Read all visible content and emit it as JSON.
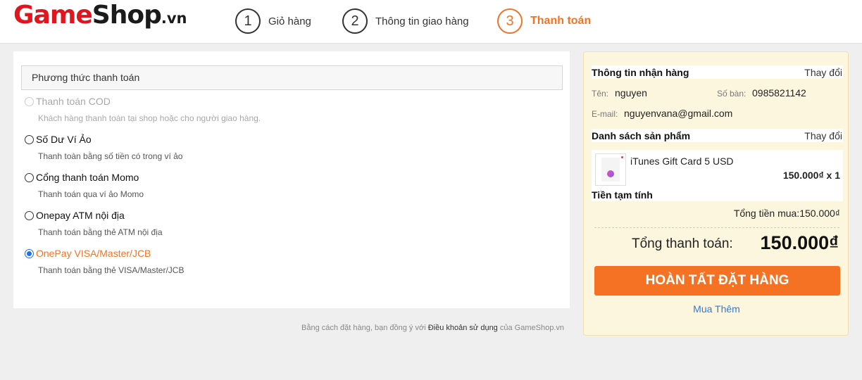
{
  "logo": {
    "part1": "Game",
    "part2": "Shop",
    "tld": ".vn"
  },
  "steps": [
    {
      "number": "1",
      "label": "Giỏ hàng"
    },
    {
      "number": "2",
      "label": "Thông tin giao hàng"
    },
    {
      "number": "3",
      "label": "Thanh toán"
    }
  ],
  "payment": {
    "header": "Phương thức thanh toán",
    "options": [
      {
        "name": "Thanh toán COD",
        "desc": "Khách hàng thanh toán tại shop hoặc cho người giao hàng."
      },
      {
        "name": "Số Dư Ví Ảo",
        "desc": "Thanh toàn bằng số tiền có trong ví ảo"
      },
      {
        "name": "Cổng thanh toán Momo",
        "desc": "Thanh toán qua ví ảo Momo"
      },
      {
        "name": "Onepay ATM nội địa",
        "desc": "Thanh toán bằng thẻ ATM nội địa"
      },
      {
        "name": "OnePay VISA/Master/JCB",
        "desc": "Thanh toán bằng thẻ VISA/Master/JCB"
      }
    ]
  },
  "terms": {
    "prefix": "Bằng cách đặt hàng, bạn đồng ý với",
    "link": "Điều khoản sử dụng",
    "suffix": "của GameShop.vn"
  },
  "receiver": {
    "title": "Thông tin nhận hàng",
    "change": "Thay đổi",
    "name_label": "Tên:",
    "name": "nguyen",
    "phone_label": "Số bàn:",
    "phone": "0985821142",
    "email_label": "E-mail:",
    "email": "nguyenvana@gmail.com"
  },
  "products": {
    "title": "Danh sách sản phẩm",
    "change": "Thay đổi",
    "items": [
      {
        "name": "iTunes Gift Card 5 USD",
        "price_qty": "150.000₫ x 1"
      }
    ],
    "subtotal_label": "Tiền tạm tính"
  },
  "summary": {
    "purchase_total": "Tổng tiền mua:150.000₫",
    "total_label": "Tổng thanh toán:",
    "total_value": "150.000₫"
  },
  "actions": {
    "complete": "HOÀN TẤT ĐẶT HÀNG",
    "more": "Mua Thêm"
  },
  "colors": {
    "accent": "#f57224",
    "brand_red": "#e0151d",
    "link": "#2f7bd6",
    "summary_bg": "#fdf6df"
  }
}
